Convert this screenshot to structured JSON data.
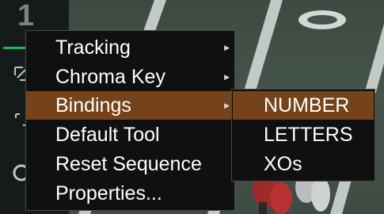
{
  "toolbar": {
    "track_number": "1",
    "tools": [
      {
        "name": "crop-icon"
      },
      {
        "name": "transform-icon"
      },
      {
        "name": "circle-tool-icon"
      }
    ]
  },
  "context_menu": {
    "items": [
      {
        "label": "Tracking",
        "has_submenu": true
      },
      {
        "label": "Chroma Key",
        "has_submenu": true
      },
      {
        "label": "Bindings",
        "has_submenu": true,
        "highlighted": true
      },
      {
        "label": "Default Tool",
        "has_submenu": false
      },
      {
        "label": "Reset Sequence",
        "has_submenu": false
      },
      {
        "label": "Properties...",
        "has_submenu": false
      }
    ]
  },
  "bindings_submenu": {
    "items": [
      {
        "label": "NUMBER",
        "highlighted": true
      },
      {
        "label": "LETTERS"
      },
      {
        "label": "XOs"
      }
    ]
  },
  "colors": {
    "menu_background": "#101010",
    "highlight": "#74431a",
    "active_tool_indicator": "#1fb94f"
  }
}
